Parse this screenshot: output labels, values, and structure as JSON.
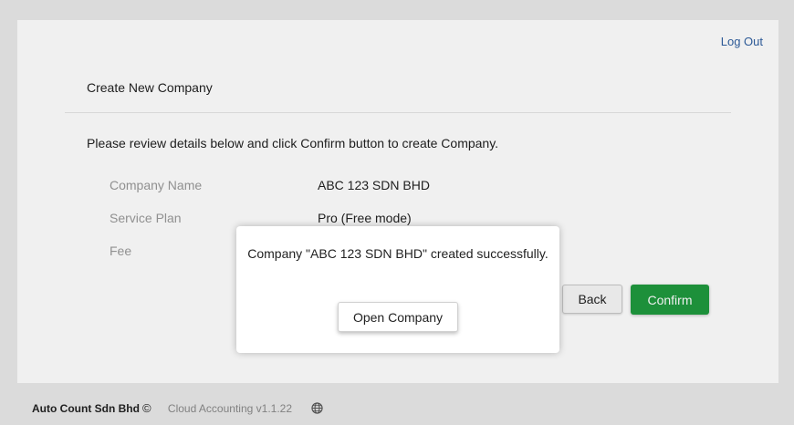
{
  "header": {
    "logout_label": "Log Out"
  },
  "page": {
    "title": "Create New Company",
    "instruction": "Please review details below and click Confirm button to create Company."
  },
  "details": [
    {
      "label": "Company Name",
      "value": "ABC 123 SDN BHD"
    },
    {
      "label": "Service Plan",
      "value": "Pro (Free mode)"
    },
    {
      "label": "Fee",
      "value": ""
    }
  ],
  "actions": {
    "back_label": "Back",
    "confirm_label": "Confirm"
  },
  "footer": {
    "company": "Auto Count Sdn Bhd",
    "copyright_symbol": "©",
    "version": "Cloud Accounting v1.1.22",
    "globe_icon": "globe-icon"
  },
  "dialog": {
    "message": "Company \"ABC 123 SDN BHD\" created successfully.",
    "open_label": "Open Company"
  },
  "colors": {
    "accent_green": "#1f9a3e",
    "link_blue": "#2f5fa0"
  }
}
